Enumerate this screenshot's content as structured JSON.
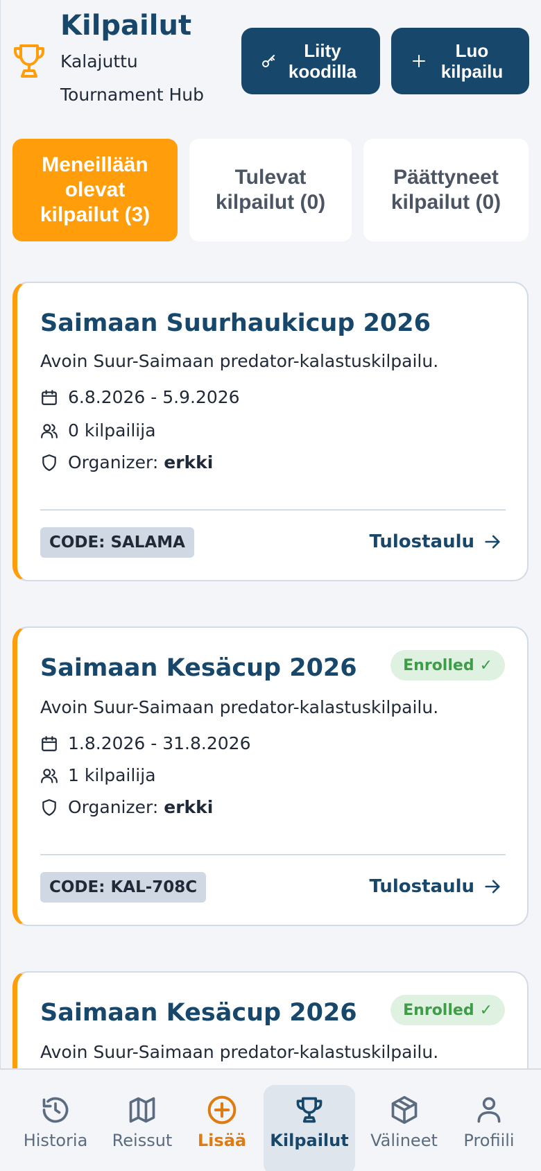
{
  "header": {
    "title": "Kilpailut",
    "subtitle_line1": "Kalajuttu",
    "subtitle_line2": "Tournament Hub",
    "join_button": {
      "line1": "Liity",
      "line2": "koodilla",
      "icon": "key-icon"
    },
    "create_button": {
      "line1": "Luo",
      "line2": "kilpailu",
      "icon": "plus-icon"
    }
  },
  "tabs": [
    {
      "lines": [
        "Meneillään",
        "olevat",
        "kilpailut (3)"
      ],
      "active": true
    },
    {
      "lines": [
        "Tulevat",
        "kilpailut (0)"
      ],
      "active": false
    },
    {
      "lines": [
        "Päättyneet",
        "kilpailut (0)"
      ],
      "active": false
    }
  ],
  "competitions": [
    {
      "title": "Saimaan Suurhaukicup 2026",
      "description": "Avoin Suur-Saimaan predator-kalastuskilpailu.",
      "dates": "6.8.2026 - 5.9.2026",
      "participants": "0 kilpailija",
      "organizer_label": "Organizer:",
      "organizer": "erkki",
      "code": "CODE: SALAMA",
      "leaderboard": "Tulostaulu"
    },
    {
      "title": "Saimaan Kesäcup 2026",
      "badge": "Enrolled",
      "badge_check": "✓",
      "description": "Avoin Suur-Saimaan predator-kalastuskilpailu.",
      "dates": "1.8.2026 - 31.8.2026",
      "participants": "1 kilpailija",
      "organizer_label": "Organizer:",
      "organizer": "erkki",
      "code": "CODE: KAL-708C",
      "leaderboard": "Tulostaulu"
    },
    {
      "title": "Saimaan Kesäcup 2026",
      "badge": "Enrolled",
      "badge_check": "✓",
      "description": "Avoin Suur-Saimaan predator-kalastuskilpailu."
    }
  ],
  "bottom_nav": [
    {
      "label": "Historia",
      "icon": "history-icon"
    },
    {
      "label": "Reissut",
      "icon": "map-icon"
    },
    {
      "label": "Lisää",
      "icon": "plus-circle-icon"
    },
    {
      "label": "Kilpailut",
      "icon": "trophy-icon",
      "active": true
    },
    {
      "label": "Välineet",
      "icon": "box-icon"
    },
    {
      "label": "Profiili",
      "icon": "user-icon"
    }
  ],
  "colors": {
    "primary": "#17476b",
    "accent": "#ff9d0a",
    "enrolled_bg": "#dff1e1",
    "enrolled_text": "#3f9d4a"
  }
}
